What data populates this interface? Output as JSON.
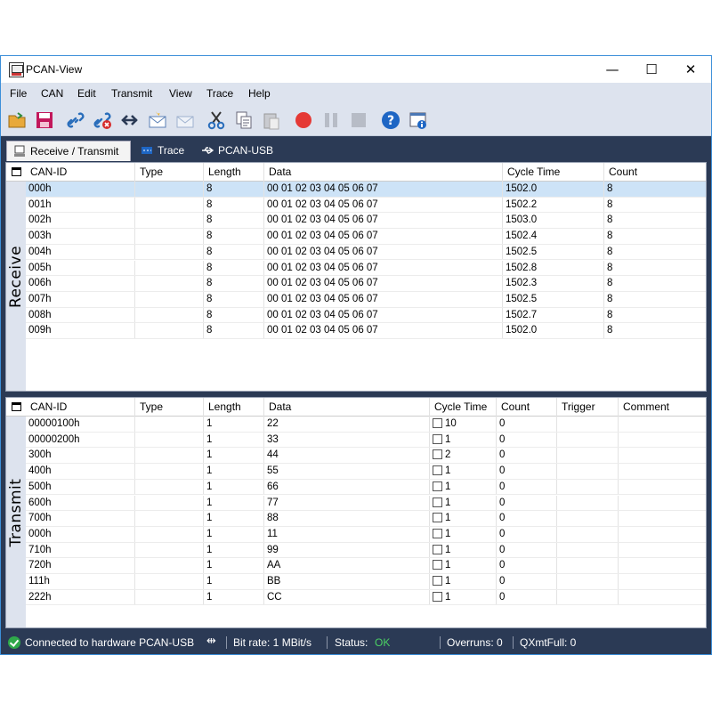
{
  "window": {
    "title": "PCAN-View",
    "minimize": "—",
    "maximize": "☐",
    "close": "✕"
  },
  "menu": [
    "File",
    "CAN",
    "Edit",
    "Transmit",
    "View",
    "Trace",
    "Help"
  ],
  "toolbar": [
    "open-folder",
    "save",
    "connect",
    "disconnect",
    "reset",
    "new-message",
    "edit-message",
    "cut",
    "copy",
    "paste",
    "record",
    "pause",
    "stop",
    "help",
    "properties"
  ],
  "tabs": [
    {
      "label": "Receive / Transmit",
      "icon": "receive-transmit-icon"
    },
    {
      "label": "Trace",
      "icon": "trace-icon"
    },
    {
      "label": "PCAN-USB",
      "icon": "usb-icon"
    }
  ],
  "receive": {
    "side_label": "Receive",
    "columns": [
      "CAN-ID",
      "Type",
      "Length",
      "Data",
      "Cycle Time",
      "Count"
    ],
    "rows": [
      [
        "000h",
        "",
        "8",
        "00 01 02 03 04 05 06 07",
        "1502.0",
        "8"
      ],
      [
        "001h",
        "",
        "8",
        "00 01 02 03 04 05 06 07",
        "1502.2",
        "8"
      ],
      [
        "002h",
        "",
        "8",
        "00 01 02 03 04 05 06 07",
        "1503.0",
        "8"
      ],
      [
        "003h",
        "",
        "8",
        "00 01 02 03 04 05 06 07",
        "1502.4",
        "8"
      ],
      [
        "004h",
        "",
        "8",
        "00 01 02 03 04 05 06 07",
        "1502.5",
        "8"
      ],
      [
        "005h",
        "",
        "8",
        "00 01 02 03 04 05 06 07",
        "1502.8",
        "8"
      ],
      [
        "006h",
        "",
        "8",
        "00 01 02 03 04 05 06 07",
        "1502.3",
        "8"
      ],
      [
        "007h",
        "",
        "8",
        "00 01 02 03 04 05 06 07",
        "1502.5",
        "8"
      ],
      [
        "008h",
        "",
        "8",
        "00 01 02 03 04 05 06 07",
        "1502.7",
        "8"
      ],
      [
        "009h",
        "",
        "8",
        "00 01 02 03 04 05 06 07",
        "1502.0",
        "8"
      ]
    ]
  },
  "transmit": {
    "side_label": "Transmit",
    "columns": [
      "CAN-ID",
      "Type",
      "Length",
      "Data",
      "Cycle Time",
      "Count",
      "Trigger",
      "Comment"
    ],
    "rows": [
      [
        "00000100h",
        "",
        "1",
        "22",
        "10",
        "0",
        "",
        ""
      ],
      [
        "00000200h",
        "",
        "1",
        "33",
        "1",
        "0",
        "",
        ""
      ],
      [
        "300h",
        "",
        "1",
        "44",
        "2",
        "0",
        "",
        ""
      ],
      [
        "400h",
        "",
        "1",
        "55",
        "1",
        "0",
        "",
        ""
      ],
      [
        "500h",
        "",
        "1",
        "66",
        "1",
        "0",
        "",
        ""
      ],
      [
        "600h",
        "",
        "1",
        "77",
        "1",
        "0",
        "",
        ""
      ],
      [
        "700h",
        "",
        "1",
        "88",
        "1",
        "0",
        "",
        ""
      ],
      [
        "000h",
        "",
        "1",
        "11",
        "1",
        "0",
        "",
        ""
      ],
      [
        "710h",
        "",
        "1",
        "99",
        "1",
        "0",
        "",
        ""
      ],
      [
        "720h",
        "",
        "1",
        "AA",
        "1",
        "0",
        "",
        ""
      ],
      [
        "111h",
        "",
        "1",
        "BB",
        "1",
        "0",
        "",
        ""
      ],
      [
        "222h",
        "",
        "1",
        "CC",
        "1",
        "0",
        "",
        ""
      ]
    ]
  },
  "status": {
    "connection": "Connected to hardware PCAN-USB",
    "bitrate": "Bit rate: 1 MBit/s",
    "status_label": "Status:",
    "status_value": "OK",
    "overruns": "Overruns: 0",
    "qxmtfull": "QXmtFull: 0"
  },
  "colors": {
    "accent": "#2b3a55",
    "menu_bg": "#dde3ee",
    "selected_row": "#cde3f7",
    "ok": "#2ea84a"
  }
}
